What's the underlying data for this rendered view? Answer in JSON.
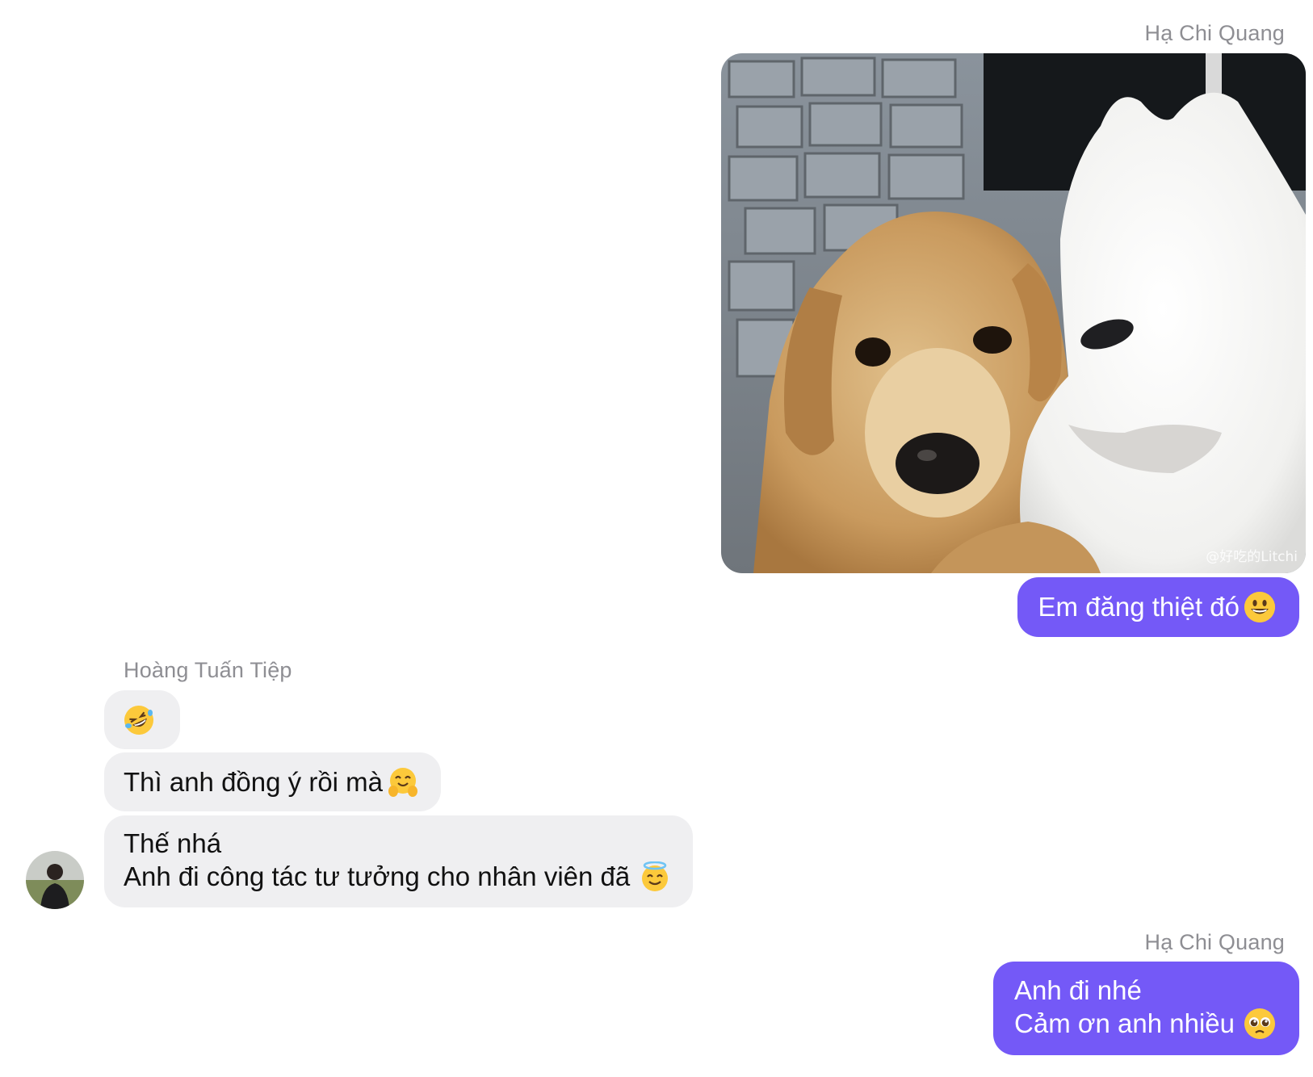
{
  "messages": {
    "m1": {
      "sender": "Hạ Chi Quang",
      "image_watermark": "@好吃的Litchi",
      "image_icon": "dogs-photo",
      "text": "Em đăng thiệt đó",
      "emoji": "grinning-face-emoji"
    },
    "m2": {
      "sender": "Hoàng Tuấn Tiệp",
      "emoji_only": "rolling-on-floor-laughing-emoji"
    },
    "m3": {
      "text": "Thì anh đồng ý rồi mà",
      "emoji": "hugging-face-emoji"
    },
    "m4": {
      "line1": "Thế nhá",
      "line2": "Anh đi công tác tư tưởng cho nhân viên đã",
      "emoji": "smiling-face-with-halo-emoji",
      "avatar_icon": "user-avatar"
    },
    "m5": {
      "sender": "Hạ Chi Quang",
      "line1": "Anh đi nhé",
      "line2": "Cảm ơn anh nhiều",
      "emoji": "pleading-face-emoji"
    }
  },
  "colors": {
    "outgoing_bubble": "#7459f7",
    "incoming_bubble": "#efeff1",
    "sender_name": "#8e8e93",
    "background": "#ffffff"
  }
}
